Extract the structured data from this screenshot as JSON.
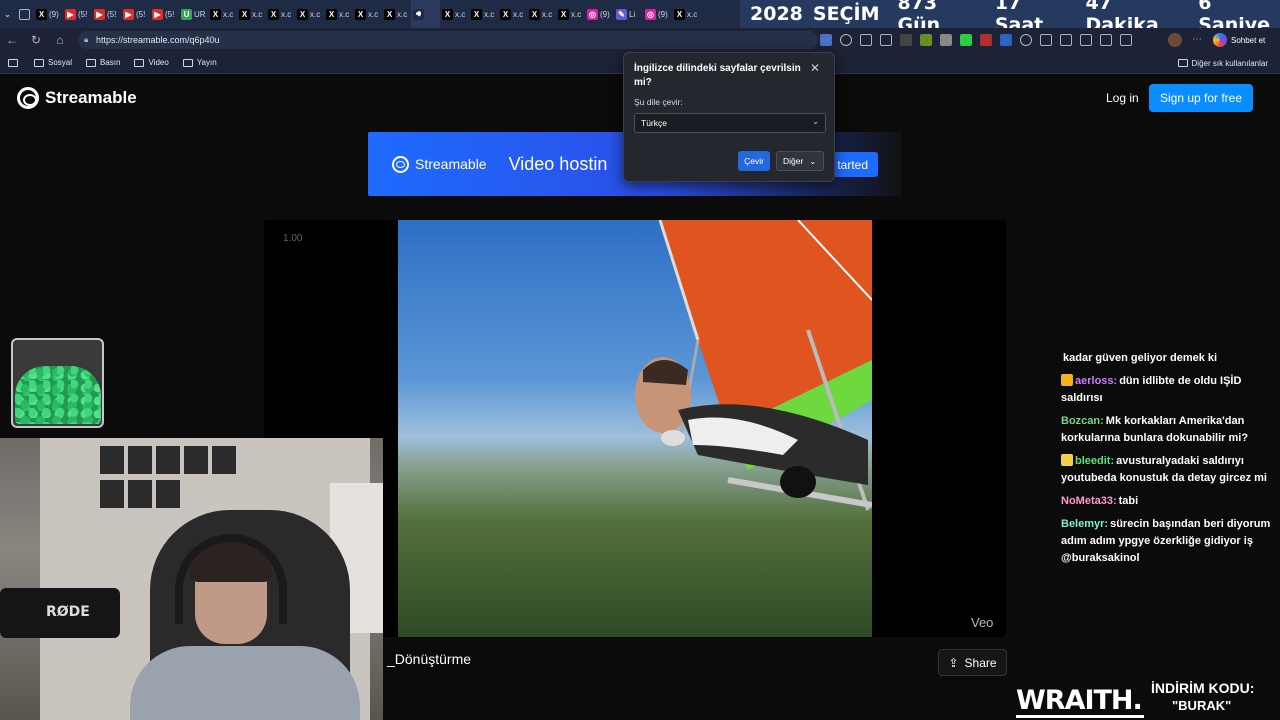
{
  "countdown": {
    "year": "2028",
    "label": "SEÇİM",
    "days": "873 Gün",
    "hours": "17 Saat",
    "minutes": "47 Dakika",
    "seconds": "6 Saniye"
  },
  "tabs": [
    {
      "icon": "x-icon",
      "text": "(9)",
      "color": "#000000"
    },
    {
      "icon": "youtube-icon",
      "text": "(5!",
      "color": "#e02b2b"
    },
    {
      "icon": "youtube-icon",
      "text": "(5!",
      "color": "#e02b2b"
    },
    {
      "icon": "youtube-icon",
      "text": "(5!",
      "color": "#e02b2b"
    },
    {
      "icon": "youtube-icon",
      "text": "(5!",
      "color": "#e02b2b"
    },
    {
      "icon": "site-icon",
      "text": "UR",
      "color": "#3aa35a"
    },
    {
      "icon": "x-icon",
      "text": "x.c",
      "color": "#000000"
    },
    {
      "icon": "x-icon",
      "text": "x.c",
      "color": "#000000"
    },
    {
      "icon": "x-icon",
      "text": "x.c",
      "color": "#000000"
    },
    {
      "icon": "x-icon",
      "text": "x.c",
      "color": "#000000"
    },
    {
      "icon": "x-icon",
      "text": "x.c",
      "color": "#000000"
    },
    {
      "icon": "x-icon",
      "text": "x.c",
      "color": "#000000"
    },
    {
      "icon": "x-icon",
      "text": "x.c",
      "color": "#000000"
    },
    {
      "icon": "speaker-icon",
      "text": "",
      "color": "#1f2a44"
    },
    {
      "icon": "x-icon",
      "text": "x.c",
      "color": "#000000"
    },
    {
      "icon": "x-icon",
      "text": "x.c",
      "color": "#000000"
    },
    {
      "icon": "x-icon",
      "text": "x.c",
      "color": "#000000"
    },
    {
      "icon": "x-icon",
      "text": "x.c",
      "color": "#000000"
    },
    {
      "icon": "x-icon",
      "text": "x.c",
      "color": "#000000"
    },
    {
      "icon": "instagram-icon",
      "text": "(9)",
      "color": "#d6249f"
    },
    {
      "icon": "pen-icon",
      "text": "Li",
      "color": "#6a5acd"
    },
    {
      "icon": "instagram-icon",
      "text": "(9)",
      "color": "#d6249f"
    },
    {
      "icon": "x-icon",
      "text": "x.c",
      "color": "#000000"
    }
  ],
  "address": {
    "url": "https://streamable.com/q6p40u"
  },
  "bookmarks": {
    "items": [
      "Sosyal",
      "Basın",
      "Video",
      "Yayın"
    ],
    "other": "Diğer sık kullanılanlar"
  },
  "toolbar": {
    "chat_label": "Sohbet et"
  },
  "site": {
    "logo": "Streamable",
    "login": "Log in",
    "signup": "Sign up for free",
    "banner_logo": "Streamable",
    "banner_title": "Video hostin",
    "banner_cta": "tarted",
    "speed": "1.00",
    "watermark": "Veo",
    "video_title": "_Dönüştürme",
    "share": "Share"
  },
  "translate": {
    "title": "İngilizce dilindeki sayfalar çevrilsin mi?",
    "label": "Şu dile çevir:",
    "language": "Türkçe",
    "translate_btn": "Çevir",
    "other_btn": "Diğer"
  },
  "webcam": {
    "mic_label": "RØDE"
  },
  "chat": [
    {
      "user": "",
      "text": "kadar güven geliyor demek ki",
      "color": "#ffffff",
      "badge": ""
    },
    {
      "user": "aerloss:",
      "text": "dün idlibte de oldu IŞİD saldırısı",
      "color": "#c77dff",
      "badge": "#f5b31a"
    },
    {
      "user": "Bozcan:",
      "text": "Mk korkakları Amerika'dan korkularına bunlara dokunabilir mi?",
      "color": "#7fd18a",
      "badge": ""
    },
    {
      "user": "bleedit:",
      "text": "avusturalyadaki saldırıyı youtubeda konustuk da detay gircez mi",
      "color": "#5fe07a",
      "badge": "#f0d24a"
    },
    {
      "user": "NoMeta33:",
      "text": "tabi",
      "color": "#ff9ad2",
      "badge": ""
    },
    {
      "user": "Belemyr:",
      "text": "sürecin başından beri diyorum adım adım ypgye özerkliğe gidiyor iş @buraksakinol",
      "color": "#7ff0c8",
      "badge": ""
    }
  ],
  "ad": {
    "brand": "WRAITH.",
    "promo_label": "İNDİRİM KODU:",
    "promo_code": "\"BURAK\""
  }
}
